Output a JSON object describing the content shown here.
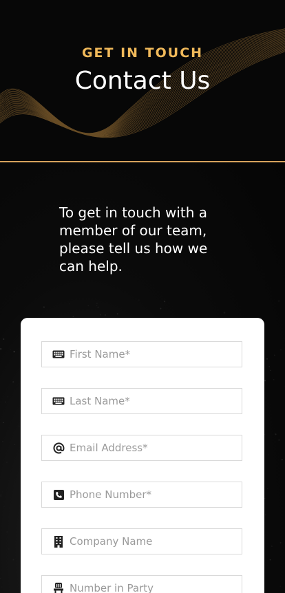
{
  "hero": {
    "eyebrow": "GET IN TOUCH",
    "title": "Contact Us"
  },
  "intro": {
    "text": "To get in touch with a member of our team, please tell us how we can help."
  },
  "form": {
    "fields": [
      {
        "placeholder": "First Name*",
        "icon": "keyboard-icon"
      },
      {
        "placeholder": "Last Name*",
        "icon": "keyboard-icon"
      },
      {
        "placeholder": "Email Address*",
        "icon": "at-sign-icon"
      },
      {
        "placeholder": "Phone Number*",
        "icon": "phone-icon"
      },
      {
        "placeholder": "Company Name",
        "icon": "building-icon"
      },
      {
        "placeholder": "Number in Party",
        "icon": "chair-icon"
      }
    ]
  },
  "colors": {
    "accent": "#f0b95a",
    "divider": "#d7a35d",
    "background": "#050505",
    "card": "#ffffff"
  }
}
